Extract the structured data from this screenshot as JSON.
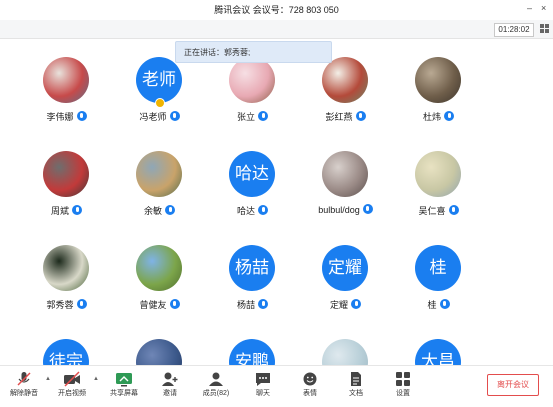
{
  "title": "腾讯会议  会议号：728 803 050",
  "window_controls": {
    "minimize": "–",
    "close": "×"
  },
  "timer": "01:28:02",
  "speaking": "正在讲话：郭秀蓉;",
  "participants": [
    {
      "name": "李伟娜",
      "avatar_text": "",
      "style": "photo",
      "colors": [
        "#e8e2dc",
        "#c74a4a",
        "#5b6f8a"
      ]
    },
    {
      "name": "冯老师",
      "avatar_text": "老师",
      "style": "text",
      "host": true
    },
    {
      "name": "张立",
      "avatar_text": "",
      "style": "photo",
      "colors": [
        "#f6dfe4",
        "#e8a9b3",
        "#8a5a44"
      ]
    },
    {
      "name": "彭红燕",
      "avatar_text": "",
      "style": "photo",
      "colors": [
        "#f3efe7",
        "#b44a3a",
        "#6a8a6a"
      ]
    },
    {
      "name": "杜炜",
      "avatar_text": "",
      "style": "photo",
      "colors": [
        "#b9a993",
        "#6f5e4a",
        "#3d352c"
      ]
    },
    {
      "name": "周斌",
      "avatar_text": "",
      "style": "photo",
      "colors": [
        "#6e6e6e",
        "#c23a3a",
        "#3a3a3a"
      ]
    },
    {
      "name": "余敏",
      "avatar_text": "",
      "style": "photo",
      "colors": [
        "#8fa7b7",
        "#c9a36a",
        "#4f6a4a"
      ]
    },
    {
      "name": "哈达",
      "avatar_text": "哈达",
      "style": "text"
    },
    {
      "name": "bulbul/dog",
      "avatar_text": "",
      "style": "photo",
      "colors": [
        "#d8d0cc",
        "#9a8a86",
        "#5a4e4c"
      ]
    },
    {
      "name": "吴仁喜",
      "avatar_text": "",
      "style": "photo",
      "colors": [
        "#e8e2c2",
        "#c8c7a4",
        "#8fa3b0"
      ]
    },
    {
      "name": "郭秀蓉",
      "avatar_text": "",
      "style": "photo",
      "colors": [
        "#1d2a1c",
        "#d8d8c8",
        "#3f5a2f"
      ]
    },
    {
      "name": "曾健友",
      "avatar_text": "",
      "style": "photo",
      "colors": [
        "#7fb3e6",
        "#7ca54a",
        "#4f6e2e"
      ]
    },
    {
      "name": "杨喆",
      "avatar_text": "杨喆",
      "style": "text"
    },
    {
      "name": "定耀",
      "avatar_text": "定耀",
      "style": "text"
    },
    {
      "name": "桂",
      "avatar_text": "桂",
      "style": "text"
    },
    {
      "name": "",
      "avatar_text": "徒宗",
      "style": "text"
    },
    {
      "name": "",
      "avatar_text": "",
      "style": "photo",
      "colors": [
        "#6f86b6",
        "#3d5a8c",
        "#20365e"
      ]
    },
    {
      "name": "",
      "avatar_text": "安鹏",
      "style": "text"
    },
    {
      "name": "",
      "avatar_text": "",
      "style": "photo",
      "colors": [
        "#dfe9ee",
        "#b8cfd8",
        "#9bb5c0"
      ]
    },
    {
      "name": "",
      "avatar_text": "大昌",
      "style": "text"
    }
  ],
  "toolbar": {
    "mute": "解除静音",
    "video": "开启视频",
    "share": "共享屏幕",
    "invite": "邀请",
    "members": "成员(82)",
    "chat": "聊天",
    "reactions": "表情",
    "docs": "文档",
    "settings": "设置",
    "leave": "离开会议"
  },
  "colors": {
    "accent": "#1a7ef0",
    "leave": "#e34d4d"
  }
}
